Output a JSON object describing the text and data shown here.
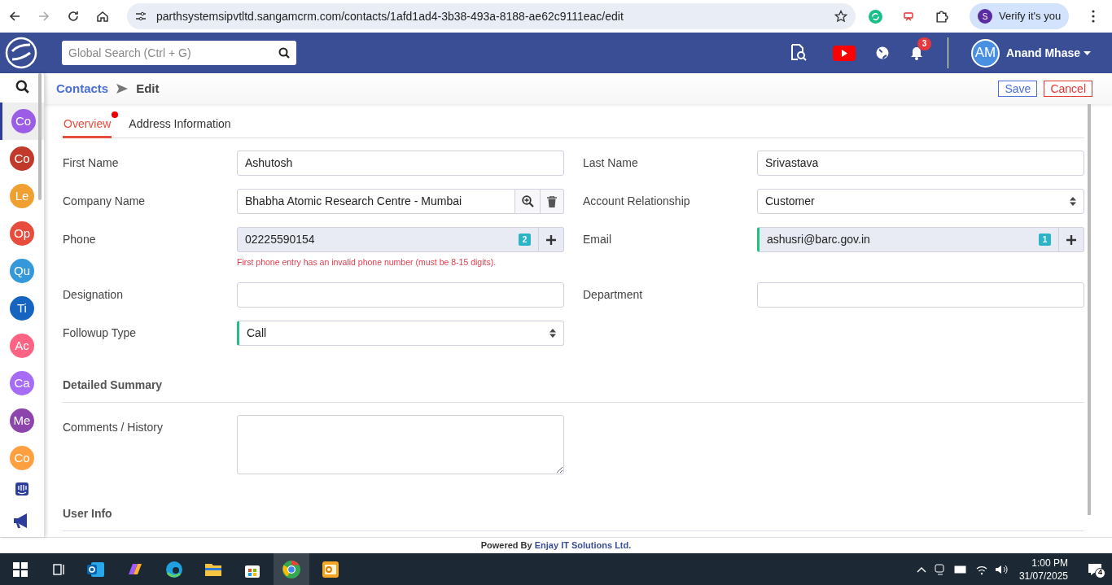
{
  "browser": {
    "url": "parthsystemsipvtltd.sangamcrm.com/contacts/1afd1ad4-3b38-493a-8188-ae62c9111eac/edit",
    "profile_initial": "S",
    "profile_label": "Verify it's you"
  },
  "header": {
    "search_placeholder": "Global Search (Ctrl + G)",
    "notification_count": "3",
    "user_initials": "AM",
    "user_name": "Anand Mhase"
  },
  "breadcrumb": [
    {
      "label": "Contacts",
      "kind": "link"
    },
    {
      "label": "Edit",
      "kind": "current"
    }
  ],
  "actions": [
    {
      "label": "Save",
      "kind": "save"
    },
    {
      "label": "Cancel",
      "kind": "cancel"
    }
  ],
  "sidebar": {
    "items": [
      {
        "label": "Co",
        "color": "#9b5de5",
        "selected": true
      },
      {
        "label": "Co",
        "color": "#c0392b",
        "selected": false
      },
      {
        "label": "Le",
        "color": "#f0a030",
        "selected": false
      },
      {
        "label": "Op",
        "color": "#e74c3c",
        "selected": false
      },
      {
        "label": "Qu",
        "color": "#3498db",
        "selected": false
      },
      {
        "label": "Ti",
        "color": "#1565c0",
        "selected": false
      },
      {
        "label": "Ac",
        "color": "#ff6384",
        "selected": false
      },
      {
        "label": "Ca",
        "color": "#a66cf5",
        "selected": false
      },
      {
        "label": "Me",
        "color": "#8e44ad",
        "selected": false
      },
      {
        "label": "Co",
        "color": "#ffa040",
        "selected": false
      }
    ]
  },
  "tabs": [
    {
      "label": "Overview",
      "selected": true,
      "has_error": true
    },
    {
      "label": "Address Information",
      "selected": false,
      "has_error": false
    }
  ],
  "fields": [
    {
      "label": "First Name",
      "kind": "text",
      "value": "Ashutosh",
      "marked": false
    },
    {
      "label": "Last Name",
      "kind": "text",
      "value": "Srivastava",
      "marked": false
    },
    {
      "label": "Company Name",
      "kind": "lookup",
      "value": "Bhabha Atomic Research Centre - Mumbai",
      "marked": false
    },
    {
      "label": "Account Relationship",
      "kind": "select",
      "value": "Customer",
      "marked": false
    },
    {
      "label": "Phone",
      "kind": "multi",
      "value": "02225590154",
      "count": "2",
      "error": "First phone entry has an invalid phone number (must be 8-15 digits).",
      "marked": false
    },
    {
      "label": "Email",
      "kind": "multi",
      "value": "ashusri@barc.gov.in",
      "count": "1",
      "marked": true
    },
    {
      "label": "Designation",
      "kind": "text",
      "marked": false
    },
    {
      "label": "Department",
      "kind": "text",
      "marked": false
    },
    {
      "label": "Followup Type",
      "kind": "select",
      "value": "Call",
      "marked": true
    }
  ],
  "sections": [
    {
      "title": "Detailed Summary",
      "fields": [
        {
          "label": "Comments / History",
          "kind": "textarea",
          "marked": false
        }
      ]
    },
    {
      "title": "User Info"
    }
  ],
  "footer": {
    "prefix": "Powered By",
    "company": "Enjay IT Solutions Ltd."
  },
  "taskbar": {
    "time": "1:00 PM",
    "date": "31/07/2025",
    "notification_count": "4"
  }
}
